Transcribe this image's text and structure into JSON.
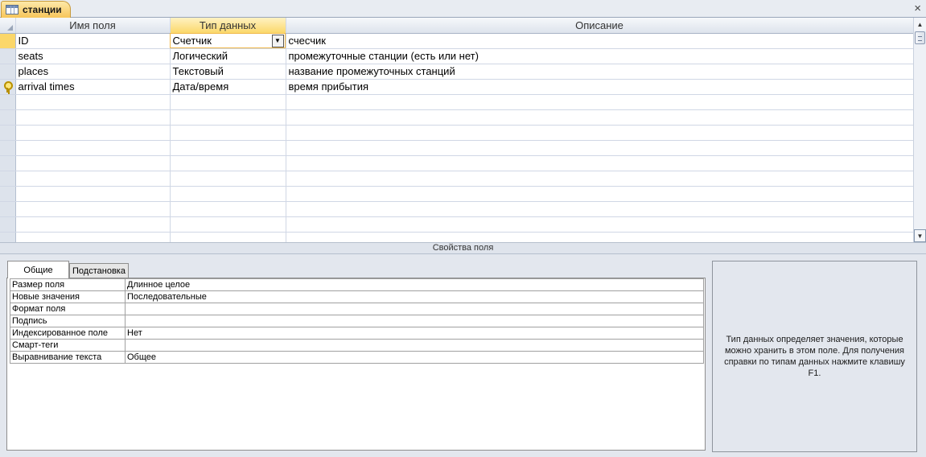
{
  "tab": {
    "title": "станции",
    "close_glyph": "×"
  },
  "grid": {
    "headers": {
      "field_name": "Имя поля",
      "data_type": "Тип данных",
      "description": "Описание"
    },
    "rows": [
      {
        "name": "ID",
        "type": "Счетчик",
        "desc": "счесчик",
        "current": true,
        "key": false
      },
      {
        "name": "seats",
        "type": "Логический",
        "desc": "промежуточные станции (есть или нет)",
        "current": false,
        "key": false
      },
      {
        "name": "places",
        "type": "Текстовый",
        "desc": "название промежуточных станций",
        "current": false,
        "key": false
      },
      {
        "name": "arrival times",
        "type": "Дата/время",
        "desc": "время прибытия",
        "current": false,
        "key": true
      }
    ],
    "empty_rows": 10
  },
  "properties": {
    "bar_title": "Свойства поля",
    "tabs": {
      "general": "Общие",
      "lookup": "Подстановка"
    },
    "rows": [
      {
        "name": "Размер поля",
        "value": "Длинное целое"
      },
      {
        "name": "Новые значения",
        "value": "Последовательные"
      },
      {
        "name": "Формат поля",
        "value": ""
      },
      {
        "name": "Подпись",
        "value": ""
      },
      {
        "name": "Индексированное поле",
        "value": "Нет"
      },
      {
        "name": "Смарт-теги",
        "value": ""
      },
      {
        "name": "Выравнивание текста",
        "value": "Общее"
      }
    ]
  },
  "help": {
    "text": "Тип данных определяет значения, которые можно хранить в этом поле. Для получения справки по типам данных нажмите клавишу F1."
  },
  "icons": {
    "table": "table-icon",
    "close": "close-icon",
    "dropdown": "chevron-down-icon",
    "key": "primary-key-icon"
  },
  "colors": {
    "active_header": "#fbd86a",
    "tab_gold": "#f7c55a",
    "grid_line": "#d0d7e5"
  }
}
